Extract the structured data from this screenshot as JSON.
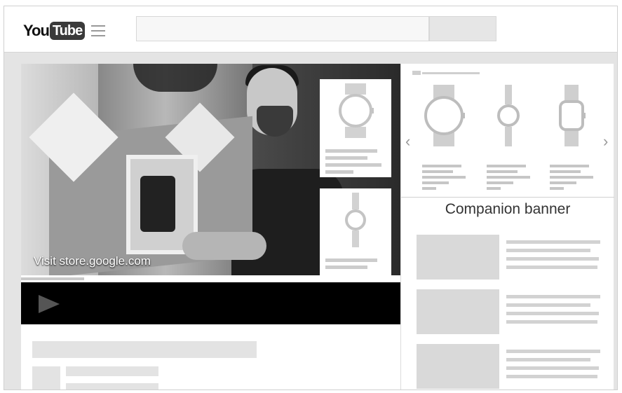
{
  "header": {
    "logo_you": "You",
    "logo_tube": "Tube",
    "menu_icon": "hamburger-menu-icon",
    "search_placeholder": ""
  },
  "video": {
    "overlay_text": "Visit store.google.com",
    "side_cards": [
      {
        "icon": "round-watch-icon"
      },
      {
        "icon": "slim-round-watch-icon"
      }
    ]
  },
  "player": {
    "play_icon": "play-icon"
  },
  "carousel": {
    "prev_icon": "chevron-left-icon",
    "next_icon": "chevron-right-icon",
    "prev_glyph": "‹",
    "next_glyph": "›",
    "items": [
      {
        "icon": "round-watch-icon"
      },
      {
        "icon": "slim-round-watch-icon"
      },
      {
        "icon": "square-watch-icon"
      }
    ]
  },
  "companion": {
    "banner_title": "Companion banner",
    "rows": 3
  },
  "colors": {
    "background": "#e4e4e4",
    "placeholder": "#d9d9d9",
    "player_bar": "#000000"
  }
}
